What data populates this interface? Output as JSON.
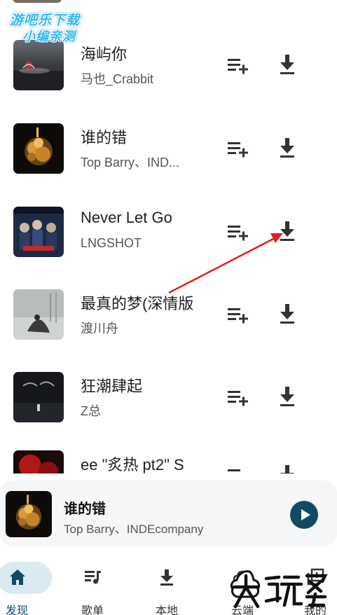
{
  "watermark": {
    "line1": "游吧乐下载",
    "line2": "小编亲测"
  },
  "songs": [
    {
      "title": "海屿你",
      "artist": "马也_Crabbit",
      "cover": "cover-sea"
    },
    {
      "title": "谁的错",
      "artist": "Top Barry、IND...",
      "cover": "cover-gold"
    },
    {
      "title": "Never Let Go",
      "artist": "LNGSHOT",
      "cover": "cover-group"
    },
    {
      "title": "最真的梦(深情版",
      "artist": "渡川舟",
      "cover": "cover-rain"
    },
    {
      "title": "狂潮肆起",
      "artist": "Z总",
      "cover": "cover-dark"
    },
    {
      "title": "ee \"炙热 pt2\" S",
      "artist": "",
      "cover": "cover-red"
    }
  ],
  "now_playing": {
    "title": "谁的错",
    "artist": "Top Barry、INDEcompany"
  },
  "nav": {
    "items": [
      {
        "label": "发现",
        "icon": "home-icon",
        "active": true
      },
      {
        "label": "歌单",
        "icon": "playlist-icon",
        "active": false
      },
      {
        "label": "本地",
        "icon": "download-icon",
        "active": false
      },
      {
        "label": "云端",
        "icon": "cloud-icon",
        "active": false
      },
      {
        "label": "我的",
        "icon": "library-icon",
        "active": false
      }
    ]
  },
  "brand_watermark": "大玩家",
  "colors": {
    "accent": "#0f4c63",
    "nav_active_pill": "#dbe9f0",
    "player_bg": "#f4f6f8",
    "annotation_arrow": "#e02020",
    "watermark_blue": "#2fb9f5"
  }
}
